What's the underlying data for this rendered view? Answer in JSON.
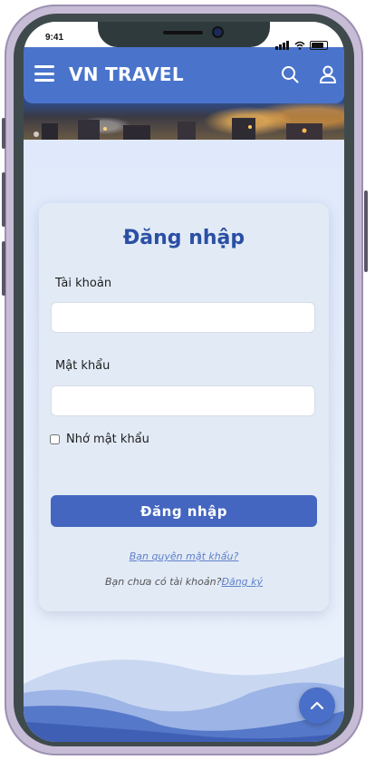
{
  "status": {
    "time": "9:41"
  },
  "header": {
    "brand": "VN TRAVEL"
  },
  "icons": {
    "menu": "hamburger-icon",
    "search": "search-icon",
    "account": "user-icon",
    "scroll_top": "chevron-up-icon"
  },
  "login": {
    "title": "Đăng nhập",
    "username_label": "Tài khoản",
    "username_value": "",
    "password_label": "Mật khẩu",
    "password_value": "",
    "remember_label": "Nhớ mật khẩu",
    "remember_checked": false,
    "submit_label": "Đăng nhập",
    "forgot_link": "Bạn quyên mật khẩu?",
    "no_account_text": "Bạn chưa có tài khoản?",
    "signup_link": "Đăng ký"
  },
  "colors": {
    "primary": "#4466c0",
    "navbar": "#4a74cc",
    "title": "#2b4fa4",
    "link": "#5f80c8",
    "page_bg": "#e3ebf8"
  }
}
